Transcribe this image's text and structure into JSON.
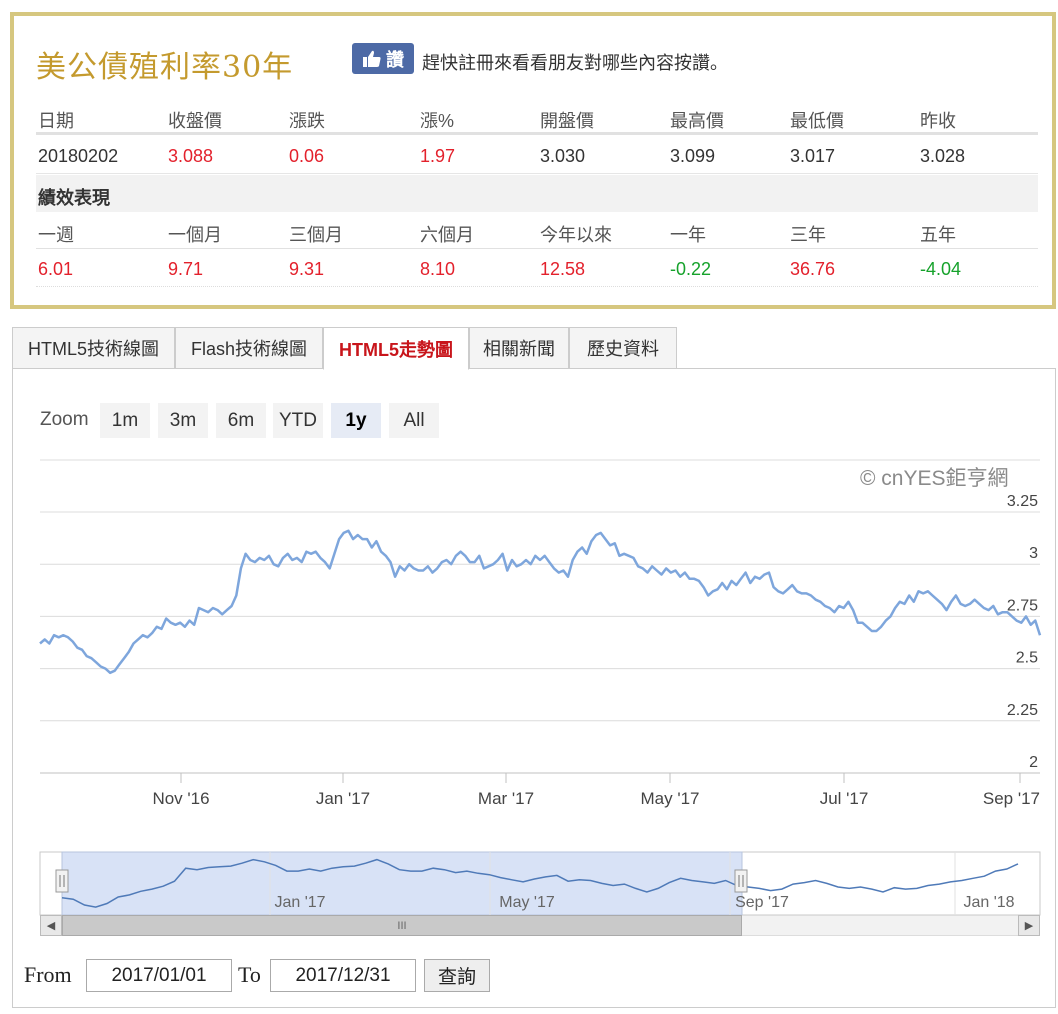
{
  "title": "美公債殖利率30年",
  "like_button": {
    "icon": "thumbs-up-icon",
    "label": "讚"
  },
  "like_prompt": "趕快註冊來看看朋友對哪些內容按讚。",
  "quote": {
    "headers": [
      "日期",
      "收盤價",
      "漲跌",
      "漲%",
      "開盤價",
      "最高價",
      "最低價",
      "昨收"
    ],
    "values": [
      "20180202",
      "3.088",
      "0.06",
      "1.97",
      "3.030",
      "3.099",
      "3.017",
      "3.028"
    ]
  },
  "performance": {
    "section_title": "績效表現",
    "headers": [
      "一週",
      "一個月",
      "三個月",
      "六個月",
      "今年以來",
      "一年",
      "三年",
      "五年"
    ],
    "values": [
      "6.01",
      "9.71",
      "9.31",
      "8.10",
      "12.58",
      "-0.22",
      "36.76",
      "-4.04"
    ]
  },
  "colors": {
    "up": "#e3212c",
    "down": "#16a22b",
    "gold": "#c49a2e",
    "series": "#7ea6dc",
    "tab_active": "#c8151b"
  },
  "tabs": [
    "HTML5技術線圖",
    "Flash技術線圖",
    "HTML5走勢圖",
    "相關新聞",
    "歷史資料"
  ],
  "active_tab": "HTML5走勢圖",
  "zoom": {
    "label": "Zoom",
    "options": [
      "1m",
      "3m",
      "6m",
      "YTD",
      "1y",
      "All"
    ],
    "selected": "1y"
  },
  "copyright": "© cnYES鉅亨網",
  "range": {
    "from_label": "From",
    "from_value": "2017/01/01",
    "to_label": "To",
    "to_value": "2017/12/31",
    "submit": "查詢"
  },
  "chart_data": {
    "type": "line",
    "series": [
      {
        "values": [
          2.62,
          2.64,
          2.62,
          2.66,
          2.65,
          2.66,
          2.65,
          2.63,
          2.6,
          2.59,
          2.56,
          2.55,
          2.53,
          2.51,
          2.5,
          2.48,
          2.49,
          2.52,
          2.55,
          2.58,
          2.62,
          2.64,
          2.66,
          2.65,
          2.67,
          2.7,
          2.69,
          2.74,
          2.72,
          2.71,
          2.72,
          2.7,
          2.73,
          2.71,
          2.79,
          2.78,
          2.77,
          2.79,
          2.78,
          2.76,
          2.78,
          2.8,
          2.85,
          2.98,
          3.05,
          3.02,
          3.01,
          3.03,
          3.02,
          3.04,
          3.0,
          2.99,
          3.03,
          3.05,
          3.02,
          3.03,
          3.01,
          3.06,
          3.05,
          3.06,
          3.03,
          3.01,
          2.98,
          3.05,
          3.12,
          3.15,
          3.16,
          3.12,
          3.14,
          3.12,
          3.12,
          3.08,
          3.11,
          3.06,
          3.04,
          3.01,
          2.94,
          2.99,
          2.97,
          3.0,
          2.98,
          2.97,
          2.97,
          2.99,
          2.96,
          2.98,
          3.01,
          3.02,
          3.0,
          3.04,
          3.06,
          3.04,
          3.01,
          3.01,
          3.04,
          2.98,
          2.99,
          3.0,
          3.02,
          3.05,
          2.97,
          3.02,
          2.99,
          3.0,
          3.02,
          3.0,
          3.04,
          3.02,
          3.04,
          3.01,
          2.98,
          2.96,
          2.97,
          2.94,
          3.02,
          3.06,
          3.08,
          3.05,
          3.11,
          3.14,
          3.15,
          3.12,
          3.09,
          3.1,
          3.04,
          3.05,
          3.04,
          3.03,
          2.99,
          2.98,
          2.96,
          2.99,
          2.97,
          2.95,
          2.98,
          2.96,
          2.97,
          2.94,
          2.96,
          2.93,
          2.93,
          2.92,
          2.89,
          2.85,
          2.87,
          2.88,
          2.91,
          2.88,
          2.92,
          2.9,
          2.93,
          2.96,
          2.91,
          2.94,
          2.93,
          2.95,
          2.96,
          2.89,
          2.87,
          2.86,
          2.88,
          2.9,
          2.87,
          2.86,
          2.86,
          2.85,
          2.83,
          2.82,
          2.8,
          2.79,
          2.77,
          2.8,
          2.79,
          2.82,
          2.78,
          2.72,
          2.72,
          2.7,
          2.68,
          2.68,
          2.7,
          2.73,
          2.75,
          2.79,
          2.82,
          2.81,
          2.85,
          2.82,
          2.87,
          2.86,
          2.87,
          2.85,
          2.83,
          2.81,
          2.78,
          2.82,
          2.85,
          2.81,
          2.8,
          2.81,
          2.83,
          2.81,
          2.79,
          2.78,
          2.8,
          2.76,
          2.77,
          2.77,
          2.75,
          2.73,
          2.72,
          2.75,
          2.71,
          2.73,
          2.66
        ]
      }
    ],
    "x_range": [
      "2016-09-02",
      "2017-09-08"
    ],
    "x_ticks": [
      "Nov '16",
      "Jan '17",
      "Mar '17",
      "May '17",
      "Jul '17",
      "Sep '17"
    ],
    "y_ticks": [
      "2",
      "2.25",
      "2.5",
      "2.75",
      "3",
      "3.25"
    ],
    "ylim": [
      2,
      3.25
    ],
    "navigator": {
      "x_ticks": [
        "Jan '17",
        "May '17",
        "Sep '17",
        "Jan '18"
      ],
      "selected_range": [
        "2016-09-02",
        "2017-09-08"
      ],
      "values": [
        2.62,
        2.6,
        2.52,
        2.49,
        2.54,
        2.63,
        2.66,
        2.71,
        2.74,
        2.78,
        2.85,
        3.03,
        3.01,
        3.04,
        3.05,
        3.06,
        3.1,
        3.15,
        3.12,
        3.07,
        2.99,
        2.99,
        3.02,
        2.99,
        3.03,
        3.05,
        3.06,
        3.1,
        3.15,
        3.09,
        3.01,
        2.99,
        2.99,
        3.03,
        3.01,
        2.97,
        2.99,
        2.96,
        2.94,
        2.9,
        2.87,
        2.84,
        2.88,
        2.91,
        2.93,
        2.85,
        2.87,
        2.86,
        2.82,
        2.79,
        2.81,
        2.75,
        2.7,
        2.75,
        2.83,
        2.89,
        2.86,
        2.84,
        2.82,
        2.86,
        2.79,
        2.77,
        2.75,
        2.72,
        2.74,
        2.81,
        2.83,
        2.86,
        2.82,
        2.77,
        2.75,
        2.77,
        2.74,
        2.7,
        2.76,
        2.74,
        2.75,
        2.79,
        2.81,
        2.84,
        2.86,
        2.89,
        2.92,
        2.99,
        3.02,
        3.09
      ]
    }
  }
}
